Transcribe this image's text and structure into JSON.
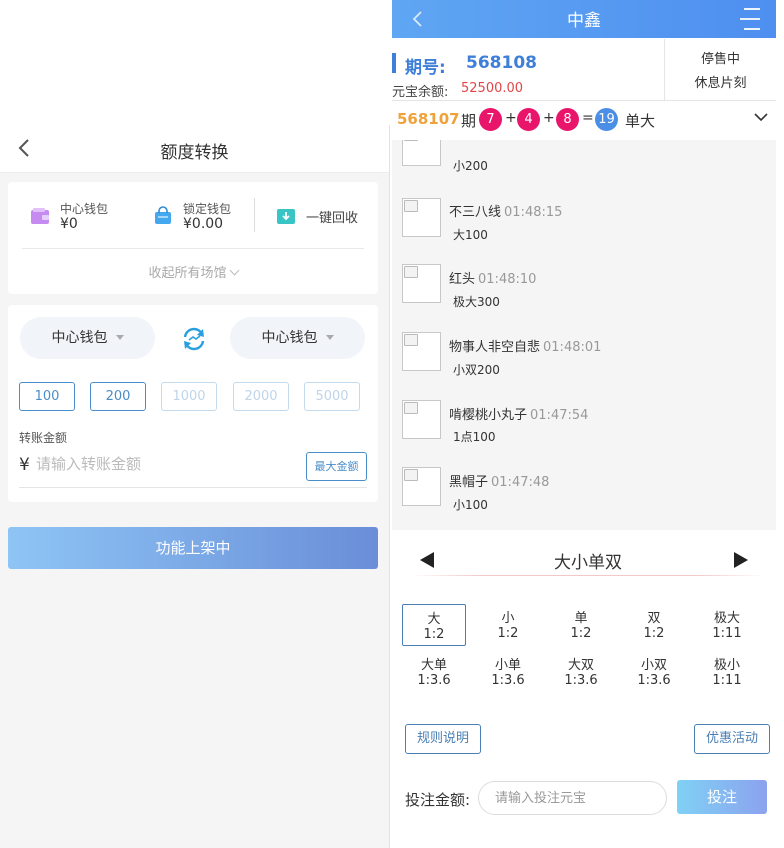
{
  "left": {
    "header": {
      "title": "额度转换"
    },
    "wallets": [
      {
        "label": "中心钱包",
        "value": "¥0"
      },
      {
        "label": "锁定钱包",
        "value": "¥0.00"
      }
    ],
    "recall_label": "一键回收",
    "collapse_label": "收起所有场馆",
    "from_wallet": "中心钱包",
    "to_wallet": "中心钱包",
    "amounts": [
      "100",
      "200",
      "1000",
      "2000",
      "5000"
    ],
    "amount_label": "转账金额",
    "currency_symbol": "¥",
    "amount_placeholder": "请输入转账金额",
    "max_label": "最大金额",
    "submit_label": "功能上架中"
  },
  "right": {
    "topbar": {
      "title": "中鑫"
    },
    "period_label": "期号:",
    "period_number": "568108",
    "balance_label": "元宝余额:",
    "balance_value": "52500.00",
    "status": [
      "停售中",
      "休息片刻"
    ],
    "last_result": {
      "period": "568107",
      "period_suffix": "期",
      "balls": [
        "7",
        "4",
        "8"
      ],
      "plus": "+",
      "equals": "=",
      "sum": "19",
      "outcome": "单大"
    },
    "feed": [
      {
        "name": "",
        "time": "",
        "bet": "小200"
      },
      {
        "name": "不三八线",
        "time": "01:48:15",
        "bet": "大100"
      },
      {
        "name": "红头",
        "time": "01:48:10",
        "bet": "极大300"
      },
      {
        "name": "物事人非空自悲",
        "time": "01:48:01",
        "bet": "小双200"
      },
      {
        "name": "啃樱桃小丸子",
        "time": "01:47:54",
        "bet": "1点100"
      },
      {
        "name": "黑帽子",
        "time": "01:47:48",
        "bet": "小100"
      }
    ],
    "bet_panel": {
      "title": "大小单双",
      "options": [
        {
          "name": "大",
          "odds": "1:2",
          "selected": true
        },
        {
          "name": "小",
          "odds": "1:2"
        },
        {
          "name": "单",
          "odds": "1:2"
        },
        {
          "name": "双",
          "odds": "1:2"
        },
        {
          "name": "极大",
          "odds": "1:11"
        },
        {
          "name": "大单",
          "odds": "1:3.6"
        },
        {
          "name": "小单",
          "odds": "1:3.6"
        },
        {
          "name": "大双",
          "odds": "1:3.6"
        },
        {
          "name": "小双",
          "odds": "1:3.6"
        },
        {
          "name": "极小",
          "odds": "1:11"
        }
      ],
      "rule_label": "规则说明",
      "promo_label": "优惠活动",
      "bet_amount_label": "投注金额:",
      "bet_placeholder": "请输入投注元宝",
      "bet_button": "投注"
    }
  },
  "colors": {
    "accent_blue": "#3d7fd9",
    "ball_pink": "#e8156b",
    "ball_blue": "#4a8ee6",
    "balance_red": "#e04646",
    "period_orange": "#f0a13a"
  }
}
